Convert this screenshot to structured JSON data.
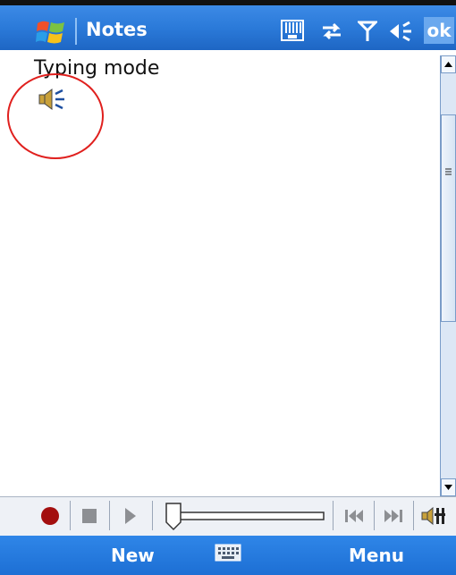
{
  "titlebar": {
    "app_title": "Notes",
    "ok_label": "ok",
    "icons": [
      "start-menu-logo",
      "input-panel-icon",
      "connectivity-icon",
      "signal-icon",
      "volume-icon"
    ]
  },
  "note": {
    "text": "Typing mode",
    "voice_note_icon": "speaker-icon"
  },
  "recorder": {
    "controls": [
      "record",
      "stop",
      "play",
      "position-slider",
      "previous",
      "next",
      "volume"
    ]
  },
  "softkeys": {
    "left_label": "New",
    "right_label": "Menu",
    "center_icon": "keyboard-icon"
  },
  "colors": {
    "titlebar": "#2b7ad9",
    "softkeys": "#1d6fd4",
    "annotation_circle": "#e0201e",
    "record_dot": "#a30f0f"
  }
}
